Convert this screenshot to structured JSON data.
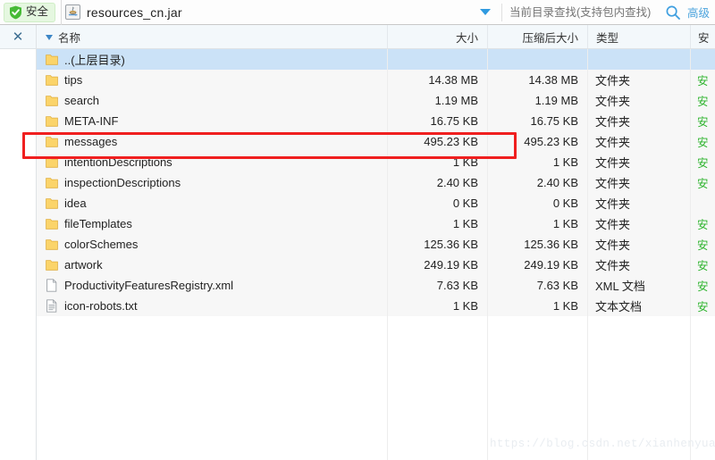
{
  "toolbar": {
    "safe_label": "安全",
    "shield_icon": "shield-check-icon",
    "archive_icon": "jar-file-icon",
    "archive_name": "resources_cn.jar",
    "dropdown_icon": "chevron-down-icon",
    "search_placeholder": "当前目录查找(支持包内查找)",
    "search_value": "",
    "search_icon": "search-icon",
    "advanced_label": "高级"
  },
  "rail": {
    "close_label": "✕",
    "close_icon": "close-icon"
  },
  "table": {
    "columns": [
      {
        "key": "name",
        "label": "名称"
      },
      {
        "key": "size",
        "label": "大小"
      },
      {
        "key": "csize",
        "label": "压缩后大小"
      },
      {
        "key": "type",
        "label": "类型"
      },
      {
        "key": "sec",
        "label": "安"
      }
    ],
    "sort_icon": "sort-descending-icon",
    "rows": [
      {
        "name": "..(上层目录)",
        "icon": "folder-icon",
        "size": "",
        "csize": "",
        "type": "",
        "sec": "",
        "selected": true
      },
      {
        "name": "tips",
        "icon": "folder-icon",
        "size": "14.38 MB",
        "csize": "14.38 MB",
        "type": "文件夹",
        "sec": "安",
        "selected": false
      },
      {
        "name": "search",
        "icon": "folder-icon",
        "size": "1.19 MB",
        "csize": "1.19 MB",
        "type": "文件夹",
        "sec": "安",
        "selected": false
      },
      {
        "name": "META-INF",
        "icon": "folder-icon",
        "size": "16.75 KB",
        "csize": "16.75 KB",
        "type": "文件夹",
        "sec": "安",
        "selected": false
      },
      {
        "name": "messages",
        "icon": "folder-icon",
        "size": "495.23 KB",
        "csize": "495.23 KB",
        "type": "文件夹",
        "sec": "安",
        "selected": false
      },
      {
        "name": "intentionDescriptions",
        "icon": "folder-icon",
        "size": "1 KB",
        "csize": "1 KB",
        "type": "文件夹",
        "sec": "安",
        "selected": false
      },
      {
        "name": "inspectionDescriptions",
        "icon": "folder-icon",
        "size": "2.40 KB",
        "csize": "2.40 KB",
        "type": "文件夹",
        "sec": "安",
        "selected": false
      },
      {
        "name": "idea",
        "icon": "folder-icon",
        "size": "0 KB",
        "csize": "0 KB",
        "type": "文件夹",
        "sec": "",
        "selected": false
      },
      {
        "name": "fileTemplates",
        "icon": "folder-icon",
        "size": "1 KB",
        "csize": "1 KB",
        "type": "文件夹",
        "sec": "安",
        "selected": false
      },
      {
        "name": "colorSchemes",
        "icon": "folder-icon",
        "size": "125.36 KB",
        "csize": "125.36 KB",
        "type": "文件夹",
        "sec": "安",
        "selected": false
      },
      {
        "name": "artwork",
        "icon": "folder-icon",
        "size": "249.19 KB",
        "csize": "249.19 KB",
        "type": "文件夹",
        "sec": "安",
        "selected": false
      },
      {
        "name": "ProductivityFeaturesRegistry.xml",
        "icon": "xml-file-icon",
        "size": "7.63 KB",
        "csize": "7.63 KB",
        "type": "XML 文档",
        "sec": "安",
        "selected": false
      },
      {
        "name": "icon-robots.txt",
        "icon": "text-file-icon",
        "size": "1 KB",
        "csize": "1 KB",
        "type": "文本文档",
        "sec": "安",
        "selected": false
      }
    ]
  },
  "annotation": {
    "target_row": "messages",
    "color": "#f01f1f"
  },
  "watermark": {
    "text": "https://blog.csdn.net/xianhenyuan"
  },
  "colors": {
    "selection": "#cbe2f7",
    "header_bg": "#f3f8fb",
    "row_bg": "#f7f7f7",
    "accent": "#2f9ae0",
    "safe_green": "#2bb32b",
    "annotation_red": "#f01f1f"
  }
}
